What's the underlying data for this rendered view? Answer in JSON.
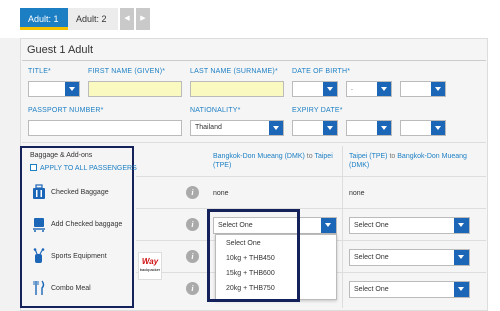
{
  "tabs": [
    {
      "label": "Adult: 1",
      "active": true
    },
    {
      "label": "Adult: 2",
      "active": false
    }
  ],
  "tab_nav": {
    "prev_icon": "chevron-left-icon",
    "next_icon": "chevron-right-icon"
  },
  "guest": {
    "title": "Guest 1 Adult"
  },
  "fields": {
    "title_label": "TITLE*",
    "first_name_label": "FIRST NAME (GIVEN)*",
    "last_name_label": "LAST NAME (SURNAME)*",
    "dob_label": "DATE OF BIRTH*",
    "dob_sep": ".",
    "passport_label": "PASSPORT NUMBER*",
    "nationality_label": "NATIONALITY*",
    "nationality_value": "Thailand",
    "expiry_label": "EXPIRY DATE*"
  },
  "baggage": {
    "heading": "Baggage & Add-ons",
    "apply_all": "APPLY TO ALL PASSENGERS",
    "routes": [
      {
        "from": "Bangkok-Don Mueang (DMK)",
        "to_word": "to",
        "to": "Taipei (TPE)"
      },
      {
        "from": "Taipei (TPE)",
        "to_word": "to",
        "to": "Bangkok-Don Mueang (DMK)"
      }
    ],
    "rows": [
      {
        "label": "Checked Baggage",
        "icon": "luggage-icon",
        "col1": "none",
        "col2": "none"
      },
      {
        "label": "Add Checked baggage",
        "icon": "luggage-cart-icon",
        "col1": "Select One",
        "col2": "Select One"
      },
      {
        "label": "Sports Equipment",
        "icon": "golf-bag-icon",
        "col2": "Select One"
      },
      {
        "label": "Combo Meal",
        "icon": "cutlery-icon",
        "col2": "Select One"
      }
    ],
    "dropdown_options": [
      "Select One",
      "10kg + THB450",
      "15kg + THB600",
      "20kg + THB750"
    ]
  },
  "watermark": {
    "top": "Way",
    "bottom": "backpacker"
  },
  "colors": {
    "accent": "#1c7fc4",
    "caret": "#1c66b8",
    "highlight_box": "#14215a",
    "tab_underline": "#f2c200"
  }
}
